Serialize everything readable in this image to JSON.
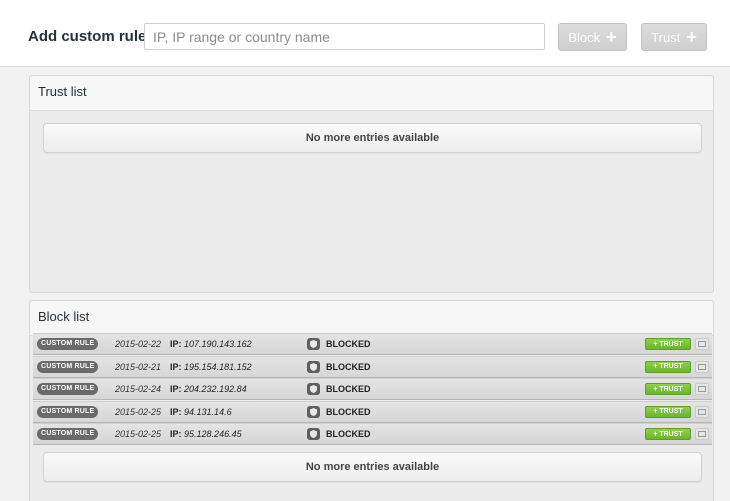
{
  "topbar": {
    "label": "Add custom rule",
    "search_placeholder": "IP, IP range or country name",
    "search_value": "",
    "block_button": "Block",
    "trust_button": "Trust"
  },
  "trust_list": {
    "title": "Trust list",
    "empty_message": "No more entries available"
  },
  "block_list": {
    "title": "Block list",
    "empty_message": "No more entries available",
    "rows": [
      {
        "tag": "CUSTOM RULE",
        "date": "2015-02-22",
        "ip_label": "IP:",
        "ip": "107.190.143.162",
        "status": "BLOCKED",
        "trust_label": "+ TRUST"
      },
      {
        "tag": "CUSTOM RULE",
        "date": "2015-02-21",
        "ip_label": "IP:",
        "ip": "195.154.181.152",
        "status": "BLOCKED",
        "trust_label": "+ TRUST"
      },
      {
        "tag": "CUSTOM RULE",
        "date": "2015-02-24",
        "ip_label": "IP:",
        "ip": "204.232.192.84",
        "status": "BLOCKED",
        "trust_label": "+ TRUST"
      },
      {
        "tag": "CUSTOM RULE",
        "date": "2015-02-25",
        "ip_label": "IP:",
        "ip": "94.131.14.6",
        "status": "BLOCKED",
        "trust_label": "+ TRUST"
      },
      {
        "tag": "CUSTOM RULE",
        "date": "2015-02-25",
        "ip_label": "IP:",
        "ip": "95.128.246.45",
        "status": "BLOCKED",
        "trust_label": "+ TRUST"
      }
    ]
  },
  "colors": {
    "trust_green": "#7bc23b",
    "disabled_button": "#d4d4d4",
    "tag_gray": "#6a6a6a"
  },
  "icons": {
    "plus": "plus-icon",
    "status": "shield-icon",
    "delete": "delete-icon"
  }
}
